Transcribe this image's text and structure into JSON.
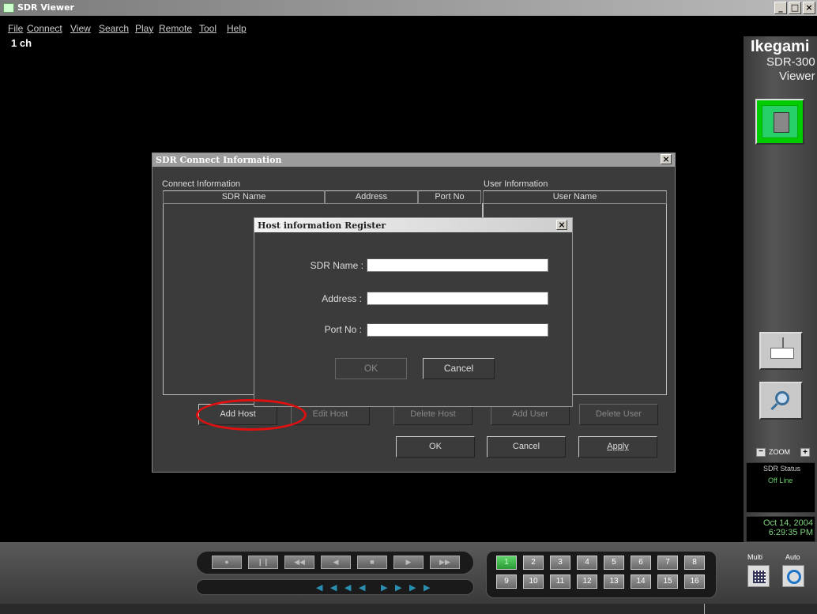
{
  "window": {
    "title": "SDR Viewer",
    "buttons": [
      "_",
      "6",
      "×"
    ]
  },
  "menu": [
    "File",
    "Connect",
    "View",
    "Search",
    "Play",
    "Remote",
    "Tool",
    "Help"
  ],
  "video": {
    "channel": "1 ch"
  },
  "brand": {
    "name": "Ikegami",
    "model": "SDR-300",
    "viewer": "Viewer"
  },
  "zoom": {
    "label": "ZOOM",
    "minus": "−",
    "plus": "+"
  },
  "status": {
    "title": "SDR Status",
    "value": "Off Line"
  },
  "datetime": {
    "date": "Oct 14, 2004",
    "time": "6:29:35 PM"
  },
  "mode": {
    "multi": "Multi",
    "auto": "Auto"
  },
  "transport": {
    "buttons": [
      "●",
      "❙❙",
      "◀◀",
      "◀",
      "■",
      "▶",
      "▶▶"
    ],
    "shuttle": [
      "◀",
      "◀",
      "◀",
      "◀",
      "▶",
      "▶",
      "▶",
      "▶"
    ]
  },
  "channels": {
    "row1": [
      "1",
      "2",
      "3",
      "4",
      "5",
      "6",
      "7",
      "8"
    ],
    "row2": [
      "9",
      "10",
      "11",
      "12",
      "13",
      "14",
      "15",
      "16"
    ],
    "active": "1"
  },
  "connect_dialog": {
    "title": "SDR Connect Information",
    "close": "×",
    "connect_info_label": "Connect Information",
    "user_info_label": "User Information",
    "columns": {
      "sdr_name": "SDR Name",
      "address": "Address",
      "port": "Port No",
      "user_name": "User Name"
    },
    "buttons": {
      "add_host": "Add Host",
      "edit_host": "Edit Host",
      "delete_host": "Delete Host",
      "add_user": "Add User",
      "delete_user": "Delete User",
      "ok": "OK",
      "cancel": "Cancel",
      "apply": "Apply"
    }
  },
  "host_dialog": {
    "title": "Host information Register",
    "close": "×",
    "fields": {
      "sdr_name": {
        "label": "SDR Name :",
        "value": ""
      },
      "address": {
        "label": "Address :",
        "value": ""
      },
      "port": {
        "label": "Port No :",
        "value": ""
      }
    },
    "ok": "OK",
    "cancel": "Cancel"
  }
}
